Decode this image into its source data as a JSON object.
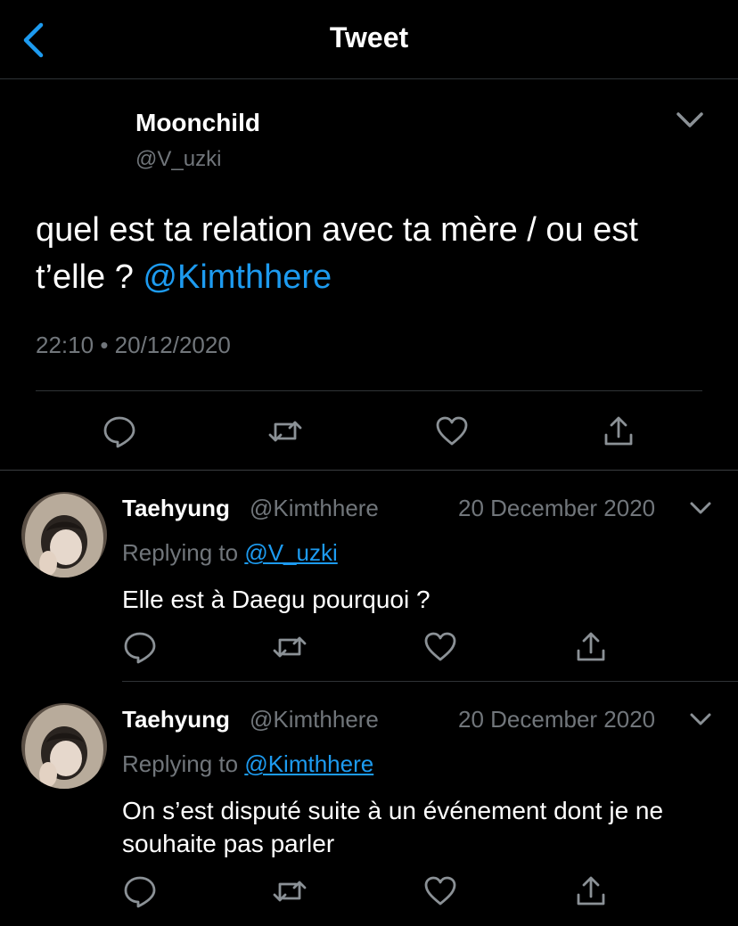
{
  "header": {
    "title": "Tweet"
  },
  "main_tweet": {
    "author": "Moonchild",
    "handle": "@V_uzki",
    "text": "quel est ta relation avec ta mère / ou est t’elle ? ",
    "mention": "@Kimthhere",
    "time": "22:10",
    "separator": "•",
    "date": "20/12/2020"
  },
  "replies": [
    {
      "name": "Taehyung",
      "handle": "@Kimthhere",
      "date": "20 December 2020",
      "replying_prefix": "Replying to ",
      "replying_to": "@V_uzki",
      "text": "Elle est à Daegu pourquoi ?"
    },
    {
      "name": "Taehyung",
      "handle": "@Kimthhere",
      "date": "20 December 2020",
      "replying_prefix": "Replying to ",
      "replying_to": "@Kimthhere",
      "text": "On s’est disputé suite à un événement dont je ne souhaite pas parler"
    }
  ],
  "icons": {
    "back": "chevron-left-icon",
    "more": "chevron-down-icon",
    "reply": "comment-icon",
    "retweet": "retweet-icon",
    "like": "heart-icon",
    "share": "share-icon"
  },
  "colors": {
    "background": "#000000",
    "accent": "#1d9bf0",
    "secondary_text": "#71767b",
    "divider": "#2f3336"
  }
}
